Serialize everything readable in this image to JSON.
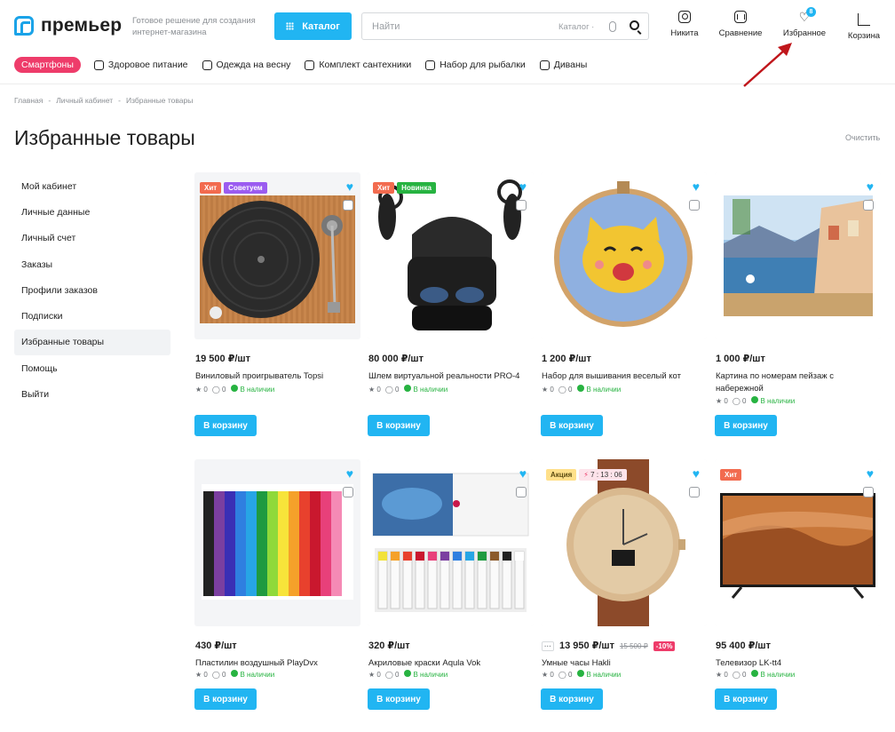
{
  "brand": {
    "name": "премьер",
    "tagline": "Готовое решение для создания интернет-магазина"
  },
  "header": {
    "catalog_label": "Каталог",
    "search": {
      "placeholder": "Найти",
      "scope": "Каталог ·"
    },
    "nav": [
      {
        "label": "Никита",
        "icon": "user-icon"
      },
      {
        "label": "Сравнение",
        "icon": "compare-icon"
      },
      {
        "label": "Избранное",
        "icon": "heart-icon",
        "count": "8"
      },
      {
        "label": "Корзина",
        "icon": "cart-icon"
      }
    ]
  },
  "categories": {
    "featured": "Смартфоны",
    "items": [
      "Здоровое питание",
      "Одежда на весну",
      "Комплект сантехники",
      "Набор для рыбалки",
      "Диваны"
    ]
  },
  "breadcrumb": [
    "Главная",
    "Личный кабинет",
    "Избранные товары"
  ],
  "page": {
    "title": "Избранные товары",
    "clear_label": "Очистить"
  },
  "sidebar": [
    "Мой кабинет",
    "Личные данные",
    "Личный счет",
    "Заказы",
    "Профили заказов",
    "Подписки",
    "Избранные товары",
    "Помощь",
    "Выйти"
  ],
  "sidebar_active_index": 6,
  "common": {
    "add_to_cart": "В корзину",
    "in_stock": "В наличии",
    "rating": "0",
    "reviews": "0"
  },
  "products": [
    {
      "price": "19 500 ₽/шт",
      "name": "Виниловый проигрыватель Topsi",
      "badges": [
        "Хит",
        "Советуем"
      ]
    },
    {
      "price": "80 000 ₽/шт",
      "name": "Шлем виртуальной реальности PRO-4",
      "badges": [
        "Хит",
        "Новинка"
      ]
    },
    {
      "price": "1 200 ₽/шт",
      "name": "Набор для вышивания веселый кот",
      "badges": []
    },
    {
      "price": "1 000 ₽/шт",
      "name": "Картина по номерам пейзаж с набережной",
      "badges": []
    },
    {
      "price": "430 ₽/шт",
      "name": "Пластилин воздушный PlayDvx",
      "badges": []
    },
    {
      "price": "320 ₽/шт",
      "name": "Акриловые краски Aqula Vok",
      "badges": []
    },
    {
      "price": "13 950 ₽/шт",
      "old_price": "15 500 ₽",
      "discount": "-10%",
      "name": "Умные часы Hakli",
      "badges": [
        "Акция"
      ],
      "timer": "7 : 13 : 06"
    },
    {
      "price": "95 400 ₽/шт",
      "name": "Телевизор LK-tt4",
      "badges": [
        "Хит"
      ]
    }
  ],
  "colors": {
    "accent": "#21b5f2",
    "hit": "#f26b4f",
    "new": "#27b341",
    "recommend": "#9b5cf0",
    "pill": "#ee3c6a",
    "arrow": "#c0161b"
  }
}
